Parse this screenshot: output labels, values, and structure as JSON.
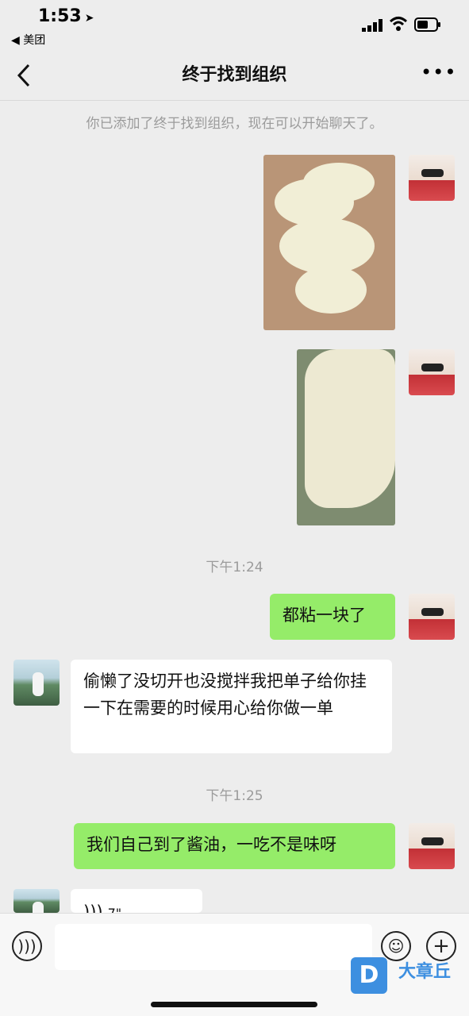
{
  "status_bar": {
    "time": "1:53",
    "back_app": "◀ 美团"
  },
  "nav": {
    "title": "终于找到组织"
  },
  "system_note": "你已添加了终于找到组织，现在可以开始聊天了。",
  "timestamps": [
    "下午1:24",
    "下午1:25"
  ],
  "messages": {
    "m1": "都粘一块了",
    "m2": "偷懒了没切开也没搅拌我把单子给你挂一下在需要的时候用心给你做一单",
    "m3": "我们自己到了酱油，一吃不是味呀",
    "m4_voice": "7\""
  },
  "input": {
    "placeholder": ""
  },
  "watermark": {
    "text": "大章丘",
    "logo": "D"
  },
  "colors": {
    "green_bubble": "#95ec69",
    "white_bubble": "#ffffff",
    "background": "#ededed"
  },
  "icons": [
    "location-arrow-icon",
    "signal-icon",
    "wifi-icon",
    "battery-icon",
    "back-chevron-icon",
    "more-icon",
    "voice-icon",
    "emoji-icon",
    "plus-icon"
  ]
}
